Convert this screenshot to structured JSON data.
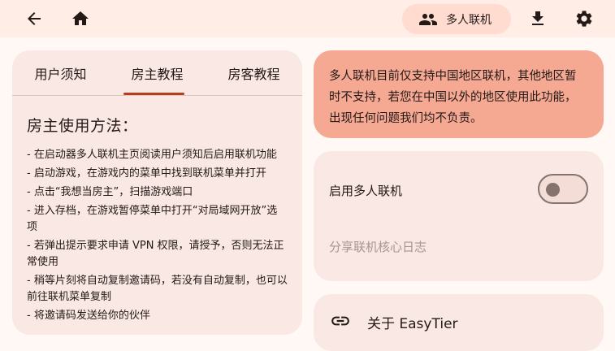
{
  "header": {
    "multiplayer_label": "多人联机",
    "icons": [
      "back-arrow-icon",
      "home-icon",
      "people-icon",
      "download-icon",
      "gear-icon"
    ]
  },
  "tabs": [
    {
      "label": "用户须知",
      "active": false
    },
    {
      "label": "房主教程",
      "active": true
    },
    {
      "label": "房客教程",
      "active": false
    }
  ],
  "guide": {
    "title": "房主使用方法：",
    "steps": [
      "- 在启动器多人联机主页阅读用户须知后启用联机功能",
      "- 启动游戏，在游戏内的菜单中找到联机菜单并打开",
      "- 点击“我想当房主”，扫描游戏端口",
      "- 进入存档，在游戏暂停菜单中打开“对局域网开放”选项",
      "- 若弹出提示要求申请 VPN 权限，请授予，否则无法正常使用",
      "- 稍等片刻将自动复制邀请码，若没有自动复制，也可以前往联机菜单复制",
      "- 将邀请码发送给你的伙伴"
    ]
  },
  "notice": {
    "text": "多人联机目前仅支持中国地区联机，其他地区暂时不支持，若您在中国以外的地区使用此功能，出现任何问题我们均不负责。"
  },
  "settings": {
    "enable_label": "启用多人联机",
    "enabled": false,
    "share_log_label": "分享联机核心日志"
  },
  "about": {
    "label": "关于 EasyTier"
  },
  "colors": {
    "accent": "#b33e1c",
    "notice_bg": "#f5a892",
    "card_bg": "#f9e8e3",
    "chip_bg": "#ffdbd0"
  }
}
